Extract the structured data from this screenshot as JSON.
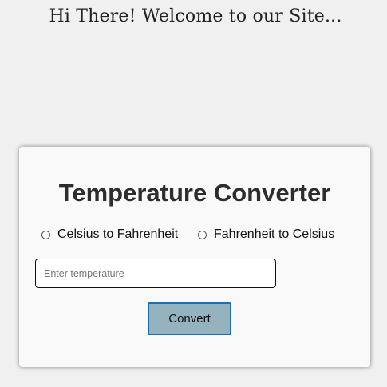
{
  "header": {
    "welcome_text": "Hi There! Welcome to our Site..."
  },
  "converter": {
    "title": "Temperature Converter",
    "options": [
      {
        "label": "Celsius to Fahrenheit",
        "selected": false
      },
      {
        "label": "Fahrenheit to Celsius",
        "selected": false
      }
    ],
    "input": {
      "value": "",
      "placeholder": "Enter temperature"
    },
    "convert_label": "Convert"
  },
  "colors": {
    "page_background": "#f0f0f0",
    "card_background": "#f9f9f9",
    "button_background": "#95b3bf",
    "button_border": "#1b6fb3"
  }
}
